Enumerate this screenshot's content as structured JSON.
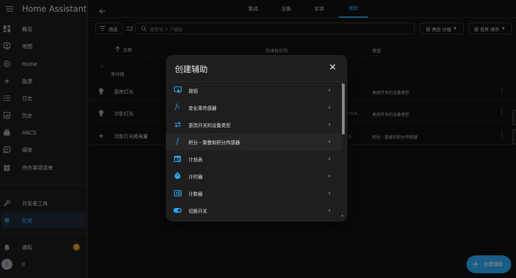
{
  "sidebar": {
    "title": "Home Assistant",
    "items": [
      {
        "label": "概览",
        "icon": "dashboard-icon"
      },
      {
        "label": "地图",
        "icon": "map-icon"
      },
      {
        "label": "Home",
        "icon": "home-icon"
      },
      {
        "label": "能源",
        "icon": "energy-icon"
      },
      {
        "label": "日志",
        "icon": "logbook-icon"
      },
      {
        "label": "历史",
        "icon": "history-icon"
      },
      {
        "label": "HACS",
        "icon": "hacs-icon"
      },
      {
        "label": "媒体",
        "icon": "media-icon"
      },
      {
        "label": "待办事项清单",
        "icon": "todo-icon"
      }
    ],
    "dev_tools": "开发者工具",
    "settings": "配置",
    "notifications": "通知",
    "notifications_count": "2",
    "user_initial": "l",
    "user_name": "ll"
  },
  "header": {
    "tabs": [
      "集成",
      "设备",
      "实体",
      "辅助"
    ],
    "active_tab": "辅助"
  },
  "toolbar": {
    "filter_label": "筛选",
    "search_placeholder": "搜索到 3 个辅助",
    "group_by": "按 类别 分组",
    "sort_by": "按 名称 排序"
  },
  "table": {
    "col_name": "名称",
    "col_entity_id": "实体标识符",
    "col_type": "类型",
    "group_label": "未分组",
    "rows": [
      {
        "name": "厨房灯光",
        "entity_id": "",
        "type": "更改开关的设备类型"
      },
      {
        "name": "次卧灯光",
        "entity_id": "_neut...",
        "type": "更改开关的设备类型"
      },
      {
        "name": "次卧灯光耗电量",
        "entity_id": "ng",
        "type": "积分 - 黎曼和积分传感器"
      }
    ]
  },
  "fab": {
    "label": "创建辅助"
  },
  "dialog": {
    "title": "创建辅助",
    "items": [
      {
        "label": "按钮",
        "icon": "button-icon"
      },
      {
        "label": "变化率传感器",
        "icon": "derivative-icon"
      },
      {
        "label": "更改开关的设备类型",
        "icon": "switch-as-x-icon"
      },
      {
        "label": "积分 - 黎曼和积分传感器",
        "icon": "integral-icon"
      },
      {
        "label": "计划表",
        "icon": "schedule-icon"
      },
      {
        "label": "计时器",
        "icon": "timer-icon"
      },
      {
        "label": "计数器",
        "icon": "counter-icon"
      },
      {
        "label": "切换开关",
        "icon": "toggle-icon"
      }
    ]
  },
  "colors": {
    "accent": "#2aa9f3",
    "badge": "#e08a16",
    "background": "#111111",
    "sidebar": "#1c1c1c"
  }
}
